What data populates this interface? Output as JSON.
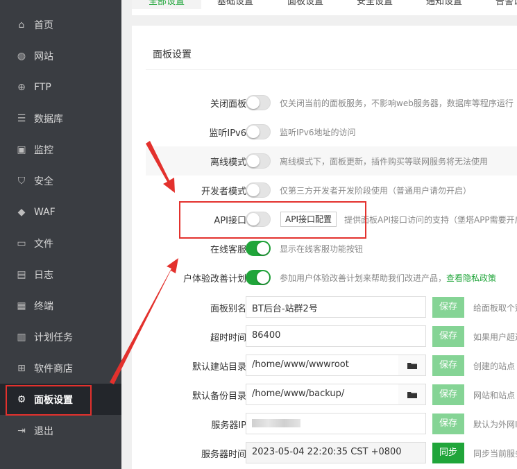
{
  "sidebar": {
    "items": [
      {
        "label": "首页",
        "icon": "home-icon",
        "glyph": "⌂"
      },
      {
        "label": "网站",
        "icon": "globe-icon",
        "glyph": "◍"
      },
      {
        "label": "FTP",
        "icon": "ftp-icon",
        "glyph": "⊕"
      },
      {
        "label": "数据库",
        "icon": "database-icon",
        "glyph": "☰"
      },
      {
        "label": "监控",
        "icon": "monitor-icon",
        "glyph": "▣"
      },
      {
        "label": "安全",
        "icon": "shield-icon",
        "glyph": "⛉"
      },
      {
        "label": "WAF",
        "icon": "waf-shield-icon",
        "glyph": "◆"
      },
      {
        "label": "文件",
        "icon": "folder-icon",
        "glyph": "▭"
      },
      {
        "label": "日志",
        "icon": "log-icon",
        "glyph": "▤"
      },
      {
        "label": "终端",
        "icon": "terminal-icon",
        "glyph": "▦"
      },
      {
        "label": "计划任务",
        "icon": "calendar-icon",
        "glyph": "▥"
      },
      {
        "label": "软件商店",
        "icon": "grid-icon",
        "glyph": "⊞"
      },
      {
        "label": "面板设置",
        "icon": "gear-icon",
        "glyph": "⚙"
      },
      {
        "label": "退出",
        "icon": "logout-icon",
        "glyph": "⇥"
      }
    ],
    "active_index": 12
  },
  "tabs": [
    "全部设置",
    "基础设置",
    "面板设置",
    "安全设置",
    "通知设置",
    "告警设置"
  ],
  "panel": {
    "title": "面板设置",
    "toggles": [
      {
        "label": "关闭面板",
        "on": false,
        "desc": "仅关闭当前的面板服务，不影响web服务器，数据库等程序运行"
      },
      {
        "label": "监听IPv6",
        "on": false,
        "desc": "监听IPv6地址的访问"
      },
      {
        "label": "离线模式",
        "on": false,
        "desc": "离线模式下，面板更新，插件购买等联网服务将无法使用"
      },
      {
        "label": "开发者模式",
        "on": false,
        "desc": "仅第三方开发者开发阶段使用（普通用户请勿开启）"
      },
      {
        "label": "API接口",
        "on": false,
        "button": "API接口配置",
        "desc": "提供面板API接口访问的支持（堡塔APP需要开启"
      },
      {
        "label": "在线客服",
        "on": true,
        "desc": "显示在线客服功能按钮"
      },
      {
        "label": "户体验改善计划",
        "on": true,
        "desc": "参加用户体验改善计划来帮助我们改进产品，",
        "link": "查看隐私政策"
      }
    ],
    "fields": [
      {
        "label": "面板别名",
        "value": "BT后台-站群2号",
        "button": "保存",
        "note": "给面板取个别"
      },
      {
        "label": "超时时间",
        "value": "86400",
        "button": "保存",
        "note": "如果用户超过"
      },
      {
        "label": "默认建站目录",
        "value": "/home/www/wwwroot",
        "button": "保存",
        "note": "创建的站点"
      },
      {
        "label": "默认备份目录",
        "value": "/home/www/backup/",
        "button": "保存",
        "note": "网站和站点"
      },
      {
        "label": "服务器IP",
        "value": "",
        "button": "保存",
        "note": "默认为外网IP"
      },
      {
        "label": "服务器时间",
        "value": "2023-05-04 22:20:35 CST +0800",
        "button": "同步",
        "note": "同步当前服务"
      }
    ]
  },
  "colors": {
    "accent": "#20a53a",
    "highlight": "#e3312d",
    "sidebar": "#3a3d42"
  }
}
